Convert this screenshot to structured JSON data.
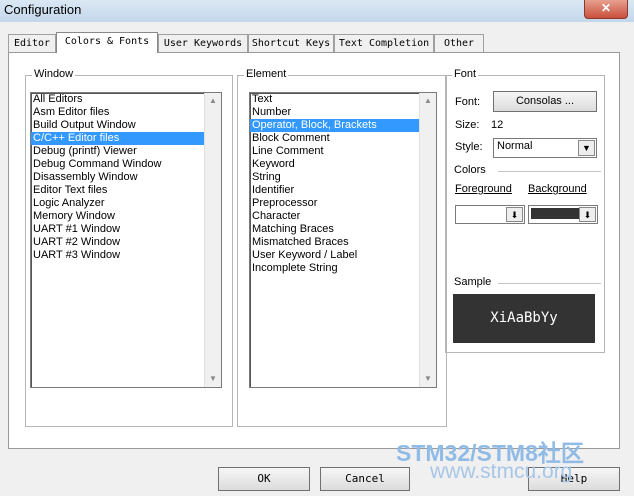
{
  "window": {
    "title": "Configuration",
    "close_label": "✕"
  },
  "tabs": [
    {
      "label": "Editor"
    },
    {
      "label": "Colors & Fonts"
    },
    {
      "label": "User Keywords"
    },
    {
      "label": "Shortcut Keys"
    },
    {
      "label": "Text Completion"
    },
    {
      "label": "Other"
    }
  ],
  "window_group": {
    "label": "Window",
    "items": [
      "All Editors",
      "Asm Editor files",
      "Build Output Window",
      "C/C++ Editor files",
      "Debug (printf) Viewer",
      "Debug Command Window",
      "Disassembly Window",
      "Editor Text files",
      "Logic Analyzer",
      "Memory Window",
      "UART #1 Window",
      "UART #2 Window",
      "UART #3 Window"
    ],
    "selected": "C/C++ Editor files"
  },
  "element_group": {
    "label": "Element",
    "items": [
      "Text",
      "Number",
      "Operator, Block, Brackets",
      "Block Comment",
      "Line Comment",
      "Keyword",
      "String",
      "Identifier",
      "Preprocessor",
      "Character",
      "Matching Braces",
      "Mismatched Braces",
      "User Keyword / Label",
      "Incomplete String"
    ],
    "selected": "Operator, Block, Brackets"
  },
  "font_group": {
    "label": "Font",
    "font_label": "Font:",
    "font_button": "Consolas ...",
    "size_label": "Size:",
    "size_value": "12",
    "style_label": "Style:",
    "style_value": "Normal"
  },
  "colors_group": {
    "label": "Colors",
    "foreground_label": "Foreground",
    "background_label": "Background",
    "foreground_color": "#ffffff",
    "background_color": "#333333"
  },
  "sample_group": {
    "label": "Sample",
    "text": "XiAaBbYy"
  },
  "buttons": {
    "ok": "OK",
    "cancel": "Cancel",
    "help": "Help"
  },
  "watermark": {
    "line1": "STM32/STM8社区",
    "line2": "www.stmcu.org"
  },
  "icons": {
    "scroll_up": "▲",
    "scroll_down": "▼",
    "dropdown": "⬇"
  }
}
